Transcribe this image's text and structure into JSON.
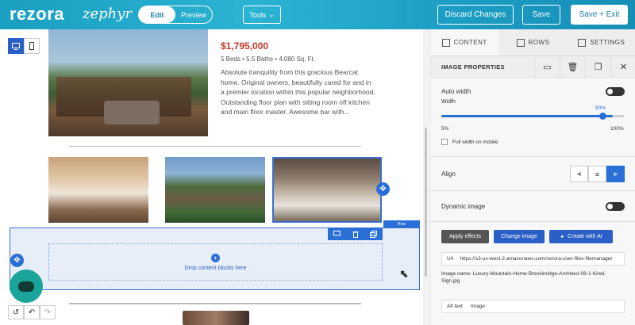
{
  "topbar": {
    "brand": "rezora",
    "brand_sub": "zephyr",
    "mode_edit": "Edit",
    "mode_preview": "Preview",
    "tools_label": "Tools",
    "discard_label": "Discard Changes",
    "save_label": "Save",
    "save_exit_label": "Save + Exit",
    "accent": "#1a9fc0"
  },
  "listing": {
    "price": "$1,795,000",
    "specs": "5 Beds  •  5.5 Baths  •  4,080 Sq. Ft.",
    "description": "Absolute tranquility from this gracious Bearcat home. Original owners, beautifully cared for and in a premier location within this popular neighborhood. Outstanding floor plan with sitting room off kitchen and main floor master. Awesome bar with..."
  },
  "canvas": {
    "drop_text": "Drop content blocks here",
    "row_tag": "Row"
  },
  "panel": {
    "tabs": [
      {
        "label": "CONTENT",
        "icon": "grid-icon"
      },
      {
        "label": "ROWS",
        "icon": "rows-icon"
      },
      {
        "label": "SETTINGS",
        "icon": "settings-icon"
      }
    ],
    "header_title": "IMAGE PROPERTIES",
    "auto_width_label": "Auto width",
    "auto_width_on": true,
    "width_label": "Width",
    "width_value": "90%",
    "width_percent": 90,
    "width_min": "5%",
    "width_max": "100%",
    "full_width_mobile_label": "Full width on mobile",
    "align_label": "Align",
    "align_selected": "right",
    "dynamic_image_label": "Dynamic image",
    "dynamic_image_on": true,
    "apply_effects_label": "Apply effects",
    "change_image_label": "Change image",
    "create_ai_label": "Create with AI",
    "url_label": "Url",
    "url_value": "https://s3-us-west-2.amazonaws.com/rezora-user-files-filemanager",
    "image_name": "Image name: Luxury-Mountain-Home-Breckinridge-Architect-08-1-Kindi-Sign.jpg",
    "alt_label": "Alt text",
    "alt_value": "Image",
    "primary_color": "#2a6fd6"
  }
}
